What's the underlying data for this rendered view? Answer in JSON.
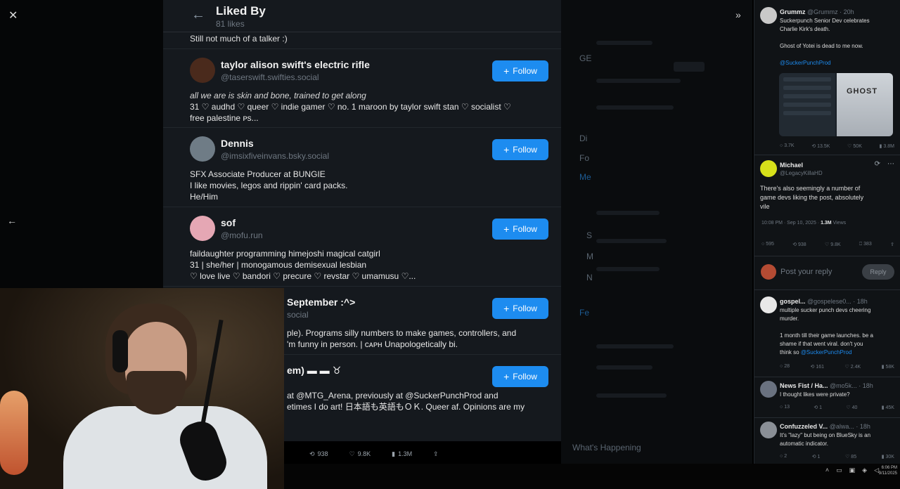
{
  "modal": {
    "title": "Liked By",
    "subtitle": "81 likes",
    "top_bio": "Still not much of a talker :)",
    "follow_label": "Follow",
    "users": [
      {
        "name": "taylor alison swift's electric rifle",
        "handle": "@taserswift.swifties.social",
        "bio_italic": "all we are is skin and bone, trained to get along",
        "bio": [
          "31 ♡ audhd ♡ queer ♡ indie gamer ♡ no. 1 maroon by taylor swift stan ♡ socialist ♡",
          "free palestine ᴘs..."
        ],
        "avatar_color": "#4a2a1c"
      },
      {
        "name": "Dennis",
        "handle": "@imsixfiveinvans.bsky.social",
        "bio": [
          "SFX Associate Producer at BUNGIE",
          "I like movies, legos and rippin' card packs.",
          "He/Him"
        ],
        "avatar_color": "#6f7c86"
      },
      {
        "name": "sof",
        "handle": "@mofu.run",
        "bio": [
          "faildaughter programming himejoshi magical catgirl",
          "31 | she/her | monogamous demisexual lesbian",
          "♡ love live ♡ bandori ♡ precure ♡ revstar ♡ umamusu ♡..."
        ],
        "avatar_color": "#e5a7b4"
      },
      {
        "name": "September :^>",
        "handle": "social",
        "bio": [
          "ple). Programs silly numbers to make games, controllers, and",
          "'m funny in person. | ᴄᴀᴘʜ Unapologetically bi."
        ],
        "avatar_color": "#15191e"
      },
      {
        "name": "em) ▬ ▬ ♉",
        "handle": "",
        "bio": [
          "at @MTG_Arena, previously at @SuckerPunchProd and",
          "etimes I do art! 日本語も英語もＯＫ. Queer af. Opinions are my"
        ],
        "avatar_color": "#15191e"
      }
    ],
    "actions": {
      "retweets": "938",
      "likes": "9.8K",
      "views": "1.3M"
    }
  },
  "middle": {
    "labels": [
      "GE",
      "Di",
      "Fo",
      "Me",
      "S",
      "M",
      "N",
      "Fe"
    ],
    "bottom_label": "What's Happening"
  },
  "right": {
    "tweet1": {
      "name": "Grummz",
      "handle": "@Grummz · 20h",
      "text": [
        "Suckerpunch Senior Dev celebrates",
        "Charlie Kirk's death.",
        "",
        "Ghost of Yotei is dead to me now."
      ],
      "link": "@SuckerPunchProd",
      "image_title": "GHOST",
      "stats": [
        "3.7K",
        "13.5K",
        "50K",
        "3.8M"
      ]
    },
    "tweet2": {
      "name": "Michael",
      "handle": "@LegacyKillaHD",
      "text": [
        "There's also seemingly a number of",
        "game devs liking the post, absolutely",
        "vile"
      ],
      "meta": "10:08 PM · Sep 10, 2025 · ",
      "views": "1.3M",
      "views_label": "Views",
      "stats": [
        "595",
        "938",
        "9.8K",
        "383"
      ]
    },
    "reply": {
      "placeholder": "Post your reply",
      "button": "Reply"
    },
    "tweet3": {
      "name": "gospel...",
      "handle": "@gospelese0... · 18h",
      "text": [
        "multiple sucker punch devs cheering",
        "murder.",
        "",
        "1 month till their game launches. be a",
        "shame if that went viral. don't you",
        "think so"
      ],
      "link": "@SuckerPunchProd",
      "stats": [
        "28",
        "161",
        "2.4K",
        "58K"
      ]
    },
    "tweet4": {
      "name": "News Fist / Ha...",
      "handle": "@mo5k... · 18h",
      "text": [
        "I thought likes were private?"
      ],
      "stats": [
        "13",
        "1",
        "40",
        "45K"
      ]
    },
    "tweet5": {
      "name": "Confuzzeled V...",
      "handle": "@alwa... · 18h",
      "text": [
        "It's \"lazy\" but being on BlueSky is an",
        "automatic indicator."
      ],
      "stats": [
        "2",
        "1",
        "85",
        "30K"
      ]
    }
  },
  "taskbar": {
    "time": "6:06 PM",
    "date": "9/11/2025"
  },
  "colors": {
    "accent": "#1d8cf0",
    "modal_bg": "#15191e",
    "page_bg": "#000000"
  }
}
